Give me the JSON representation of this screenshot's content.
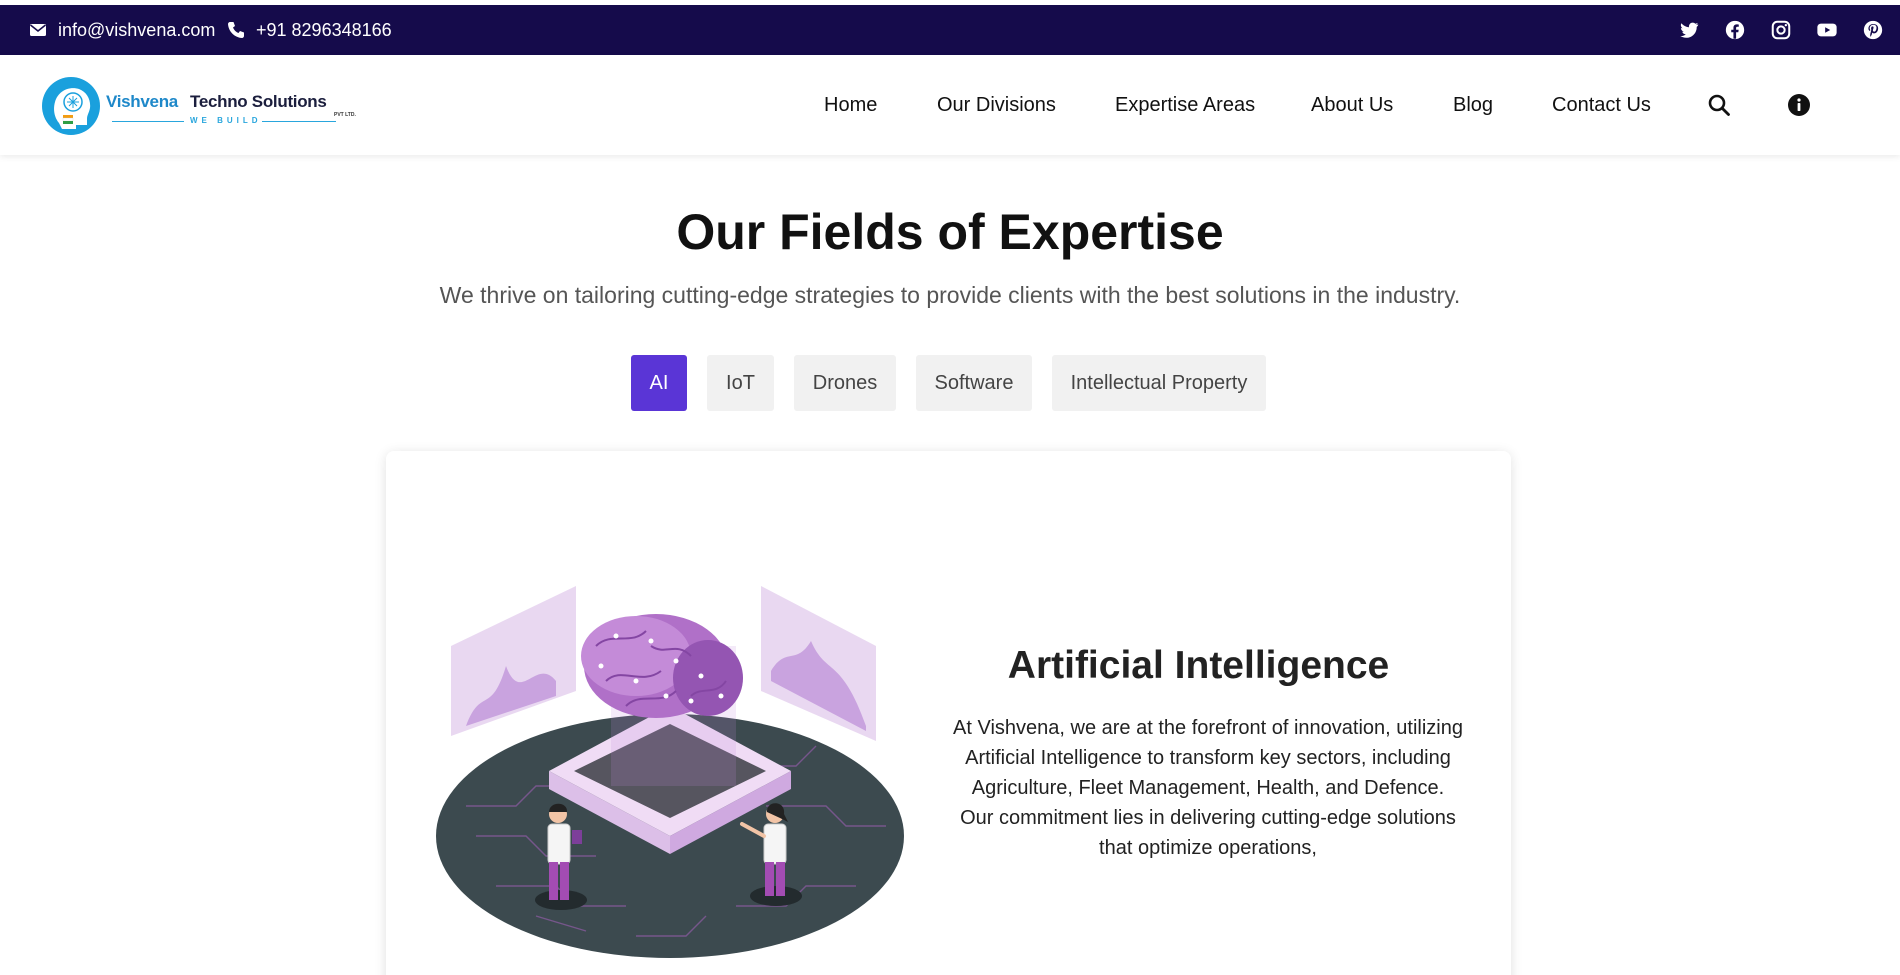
{
  "topbar": {
    "email": "info@vishvena.com",
    "phone": "+91 8296348166",
    "social_icons": [
      "twitter-icon",
      "facebook-icon",
      "instagram-icon",
      "youtube-icon",
      "pinterest-icon"
    ],
    "bg_color": "#150b4b"
  },
  "header": {
    "logo": {
      "brand_part1": "Vishvena",
      "brand_part2": "Techno Solutions",
      "pvt": "PVT LTD.",
      "tagline": "WE BUILD"
    },
    "nav": [
      {
        "label": "Home"
      },
      {
        "label": "Our Divisions"
      },
      {
        "label": "Expertise Areas"
      },
      {
        "label": "About Us"
      },
      {
        "label": "Blog"
      },
      {
        "label": "Contact Us"
      }
    ],
    "icons": [
      "search-icon",
      "info-icon"
    ]
  },
  "hero": {
    "title": "Our Fields of Expertise",
    "subtitle": "We thrive on tailoring cutting-edge strategies to provide clients with the best solutions in the industry."
  },
  "tabs": [
    {
      "label": "AI",
      "active": true
    },
    {
      "label": "IoT",
      "active": false
    },
    {
      "label": "Drones",
      "active": false
    },
    {
      "label": "Software",
      "active": false
    },
    {
      "label": "Intellectual Property",
      "active": false
    }
  ],
  "card": {
    "title": "Artificial Intelligence",
    "body": "At Vishvena, we are at the forefront of innovation, utilizing Artificial Intelligence to transform key sectors, including Agriculture, Fleet Management, Health, and Defence. Our commitment lies in delivering cutting-edge solutions that optimize operations,"
  },
  "colors": {
    "accent": "#5a35d6",
    "brand_blue": "#29a6dd",
    "tab_bg": "#f1f1f1"
  }
}
